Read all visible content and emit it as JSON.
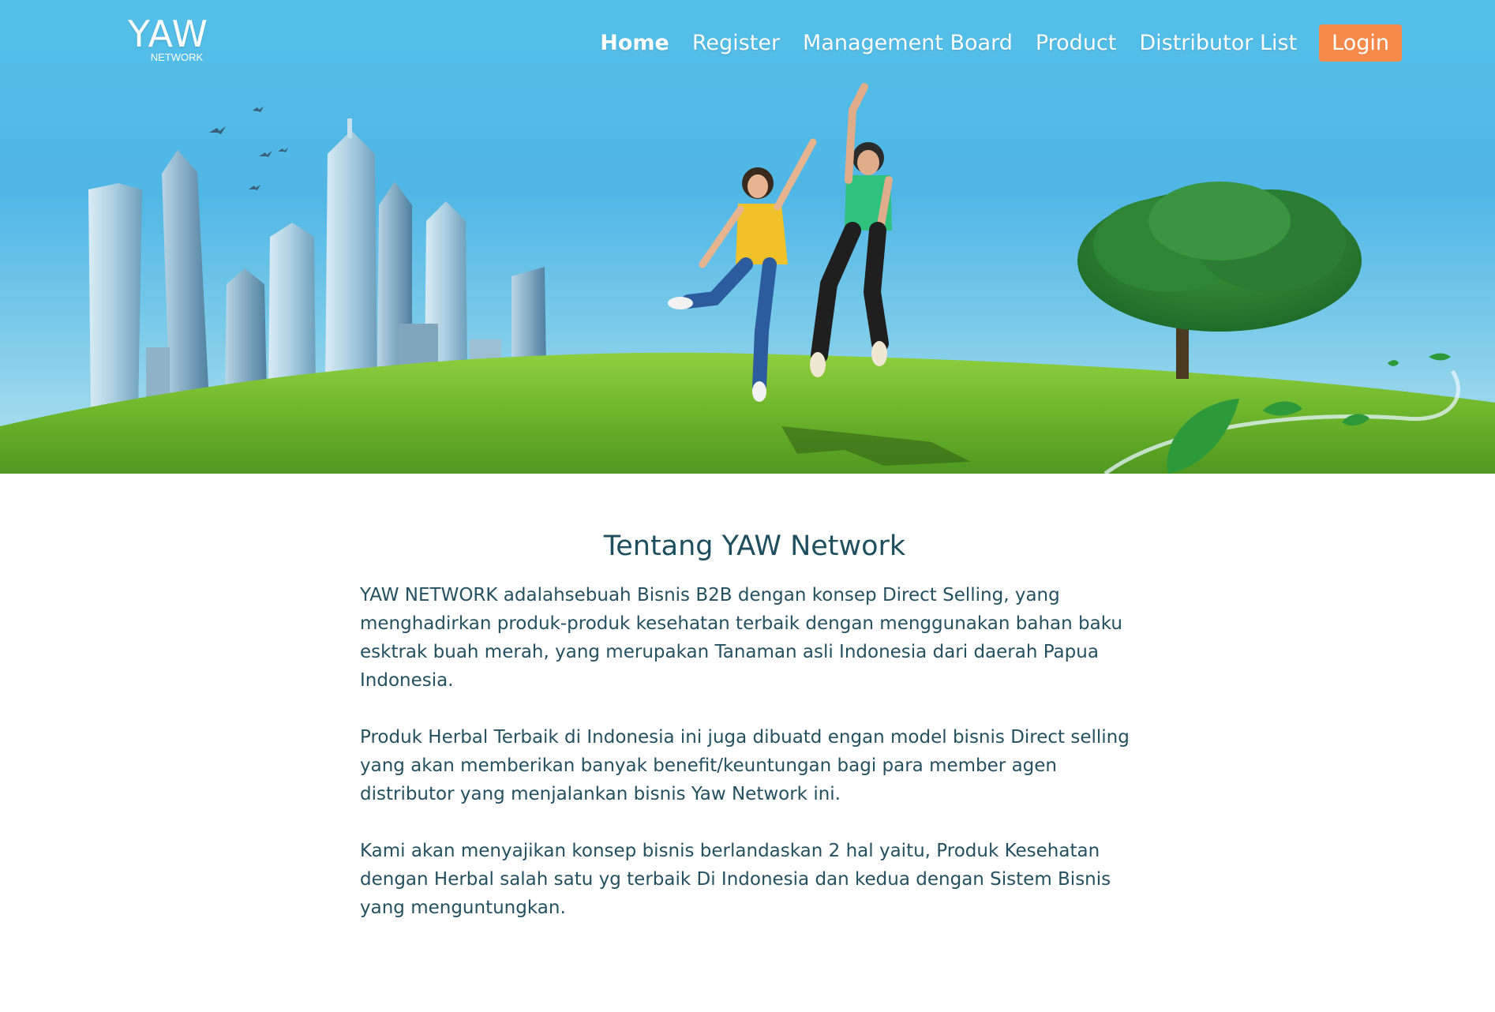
{
  "brand": {
    "logo_main": "YAW",
    "logo_sub": "NETWORK"
  },
  "nav": {
    "items": [
      {
        "label": "Home",
        "active": true
      },
      {
        "label": "Register",
        "active": false
      },
      {
        "label": "Management Board",
        "active": false
      },
      {
        "label": "Product",
        "active": false
      },
      {
        "label": "Distributor List",
        "active": false
      }
    ],
    "login_label": "Login"
  },
  "about": {
    "title": "Tentang YAW Network",
    "paragraphs": [
      "YAW NETWORK adalahsebuah Bisnis B2B dengan konsep Direct Selling, yang menghadirkan produk-produk kesehatan terbaik dengan menggunakan bahan baku esktrak buah merah, yang merupakan Tanaman asli Indonesia dari daerah Papua Indonesia.",
      "Produk Herbal Terbaik di Indonesia ini juga dibuatd engan model bisnis Direct selling yang akan memberikan banyak benefit/keuntungan bagi para member agen distributor yang menjalankan bisnis Yaw Network ini.",
      "Kami akan menyajikan konsep bisnis berlandaskan 2 hal yaitu, Produk Kesehatan dengan Herbal salah satu yg terbaik Di Indonesia dan kedua dengan Sistem Bisnis yang menguntungkan."
    ]
  },
  "colors": {
    "sky": "#4fb6e6",
    "grass": "#6db52b",
    "login_button": "#f5894a",
    "text": "#24505f",
    "title": "#1d4f5e"
  },
  "icons": {
    "hero": "hero-banner-image"
  }
}
